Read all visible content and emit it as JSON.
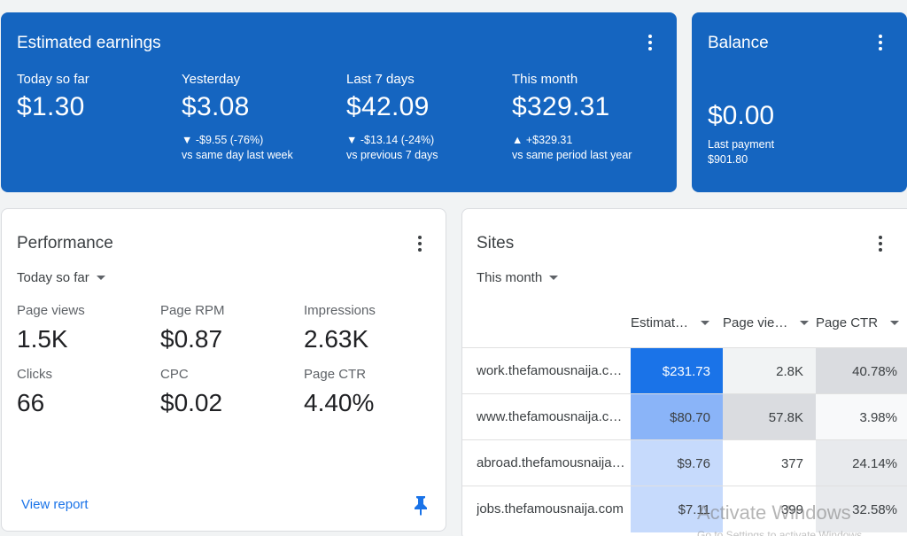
{
  "earnings": {
    "title": "Estimated earnings",
    "metrics": [
      {
        "label": "Today so far",
        "value": "$1.30",
        "change": "",
        "compare": ""
      },
      {
        "label": "Yesterday",
        "value": "$3.08",
        "change": "▼ -$9.55 (-76%)",
        "compare": "vs same day last week"
      },
      {
        "label": "Last 7 days",
        "value": "$42.09",
        "change": "▼ -$13.14 (-24%)",
        "compare": "vs previous 7 days"
      },
      {
        "label": "This month",
        "value": "$329.31",
        "change": "▲ +$329.31",
        "compare": "vs same period last year"
      }
    ]
  },
  "balance": {
    "title": "Balance",
    "value": "$0.00",
    "last_payment_label": "Last payment",
    "last_payment_value": "$901.80"
  },
  "performance": {
    "title": "Performance",
    "range": "Today so far",
    "metrics": [
      {
        "label": "Page views",
        "value": "1.5K"
      },
      {
        "label": "Page RPM",
        "value": "$0.87"
      },
      {
        "label": "Impressions",
        "value": "2.63K"
      },
      {
        "label": "Clicks",
        "value": "66"
      },
      {
        "label": "CPC",
        "value": "$0.02"
      },
      {
        "label": "Page CTR",
        "value": "4.40%"
      }
    ],
    "view_report": "View report"
  },
  "sites": {
    "title": "Sites",
    "range": "This month",
    "columns": [
      "Estimat…",
      "Page vie…",
      "Page CTR"
    ],
    "rows": [
      {
        "site": "work.thefamousnaija.com",
        "earnings": "$231.73",
        "page_views": "2.8K",
        "page_ctr": "40.78%"
      },
      {
        "site": "www.thefamousnaija.com",
        "earnings": "$80.70",
        "page_views": "57.8K",
        "page_ctr": "3.98%"
      },
      {
        "site": "abroad.thefamousnaija.com",
        "earnings": "$9.76",
        "page_views": "377",
        "page_ctr": "24.14%"
      },
      {
        "site": "jobs.thefamousnaija.com",
        "earnings": "$7.11",
        "page_views": "399",
        "page_ctr": "32.58%"
      }
    ]
  },
  "watermark": {
    "line1": "Activate Windows",
    "line2": "Go to Settings to activate Windows."
  },
  "colors": {
    "brand_blue": "#1565c0",
    "link_blue": "#1a73e8",
    "heat_strong": "#1a73e8",
    "heat_medium": "#8ab4f8",
    "heat_light": "#c6dafc"
  }
}
